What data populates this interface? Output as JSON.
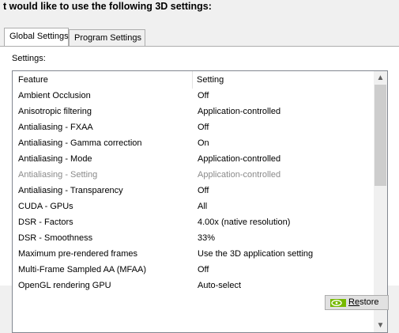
{
  "heading": "t would like to use the following 3D settings:",
  "tabs": [
    {
      "label": "Global Settings",
      "active": true
    },
    {
      "label": "Program Settings",
      "active": false
    }
  ],
  "settings_label": "Settings:",
  "columns": {
    "feature": "Feature",
    "setting": "Setting"
  },
  "rows": [
    {
      "feature": "Ambient Occlusion",
      "setting": "Off",
      "disabled": false
    },
    {
      "feature": "Anisotropic filtering",
      "setting": "Application-controlled",
      "disabled": false
    },
    {
      "feature": "Antialiasing - FXAA",
      "setting": "Off",
      "disabled": false
    },
    {
      "feature": "Antialiasing - Gamma correction",
      "setting": "On",
      "disabled": false
    },
    {
      "feature": "Antialiasing - Mode",
      "setting": "Application-controlled",
      "disabled": false
    },
    {
      "feature": "Antialiasing - Setting",
      "setting": "Application-controlled",
      "disabled": true
    },
    {
      "feature": "Antialiasing - Transparency",
      "setting": "Off",
      "disabled": false
    },
    {
      "feature": "CUDA - GPUs",
      "setting": "All",
      "disabled": false
    },
    {
      "feature": "DSR - Factors",
      "setting": "4.00x (native resolution)",
      "disabled": false
    },
    {
      "feature": "DSR - Smoothness",
      "setting": "33%",
      "disabled": false
    },
    {
      "feature": "Maximum pre-rendered frames",
      "setting": "Use the 3D application setting",
      "disabled": false
    },
    {
      "feature": "Multi-Frame Sampled AA (MFAA)",
      "setting": "Off",
      "disabled": false
    },
    {
      "feature": "OpenGL rendering GPU",
      "setting": "Auto-select",
      "disabled": false
    }
  ],
  "restore_button": {
    "label_underlined": "Re",
    "label_rest": "store",
    "icon": "nvidia-logo-icon"
  },
  "colors": {
    "accent_green": "#76b900"
  }
}
